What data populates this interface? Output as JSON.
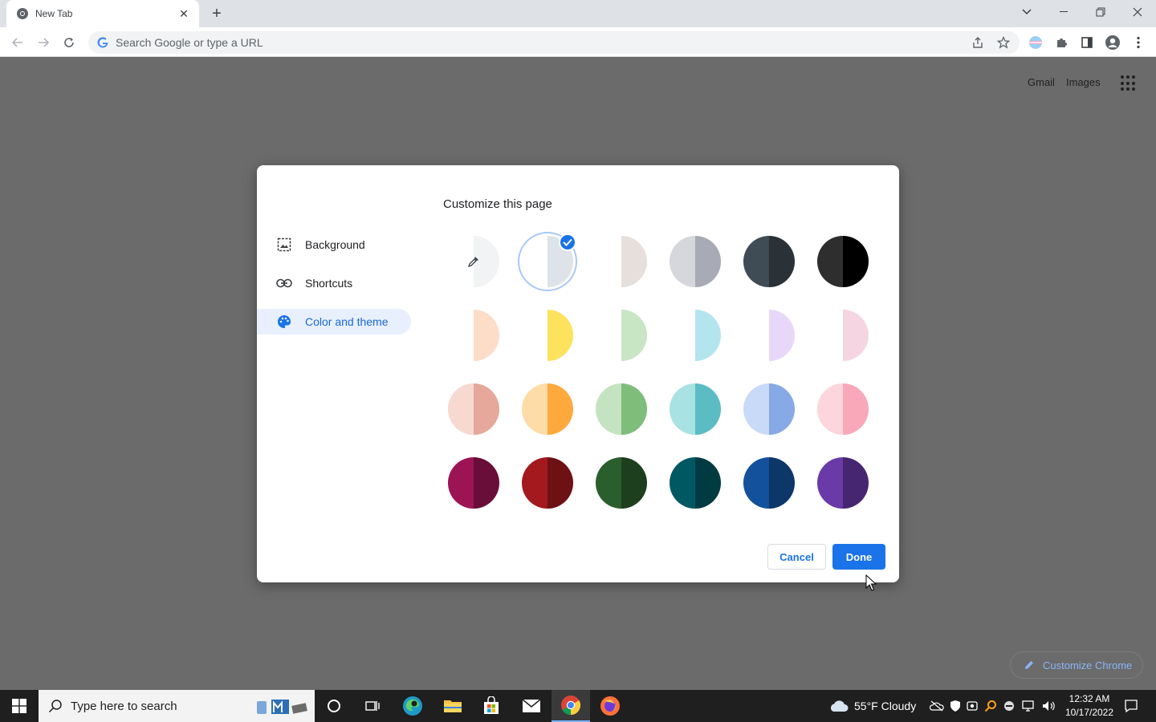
{
  "browser": {
    "tab_title": "New Tab",
    "omnibox_placeholder": "Search Google or type a URL"
  },
  "ntp": {
    "gmail": "Gmail",
    "images": "Images",
    "customize_chrome": "Customize Chrome"
  },
  "dialog": {
    "title": "Customize this page",
    "menu": [
      {
        "label": "Background",
        "icon": "image-icon"
      },
      {
        "label": "Shortcuts",
        "icon": "link-icon"
      },
      {
        "label": "Color and theme",
        "icon": "palette-icon",
        "selected": true
      }
    ],
    "swatches": [
      {
        "name": "custom-color",
        "left": "#ffffff",
        "right": "#f1f3f4",
        "icon": "eyedropper-icon"
      },
      {
        "name": "default-light",
        "left": "#ffffff",
        "right": "#dee3ea",
        "selected": true
      },
      {
        "name": "warm-grey",
        "left": "#ffffff",
        "right": "#e6dfdb"
      },
      {
        "name": "cool-grey",
        "left": "#d5d7dc",
        "right": "#a8aab5"
      },
      {
        "name": "dark-blue-grey",
        "left": "#3f4c56",
        "right": "#2a3238"
      },
      {
        "name": "black",
        "left": "#2e2e2e",
        "right": "#000000"
      },
      {
        "name": "beige-peach",
        "left": "#ffffff",
        "right": "#fddcc8"
      },
      {
        "name": "yellow",
        "left": "#ffffff",
        "right": "#fde35d"
      },
      {
        "name": "light-green",
        "left": "#ffffff",
        "right": "#c8e6c4"
      },
      {
        "name": "light-cyan",
        "left": "#ffffff",
        "right": "#b3e5ef"
      },
      {
        "name": "light-purple",
        "left": "#ffffff",
        "right": "#e7d8fa"
      },
      {
        "name": "light-pink",
        "left": "#ffffff",
        "right": "#f6d5e3"
      },
      {
        "name": "peach",
        "left": "#f7d9d2",
        "right": "#e5a89a"
      },
      {
        "name": "orange",
        "left": "#fedca8",
        "right": "#fda93d"
      },
      {
        "name": "green",
        "left": "#c4e3c0",
        "right": "#7ebd7a"
      },
      {
        "name": "cyan",
        "left": "#a8e2e3",
        "right": "#5cbcc3"
      },
      {
        "name": "blue",
        "left": "#c9daf8",
        "right": "#87a9e5"
      },
      {
        "name": "pink",
        "left": "#fcd6dc",
        "right": "#f8a8b8"
      },
      {
        "name": "magenta",
        "left": "#9d1455",
        "right": "#690d39"
      },
      {
        "name": "red",
        "left": "#a3191d",
        "right": "#6e1114"
      },
      {
        "name": "dark-green",
        "left": "#2b5e2d",
        "right": "#1d3f1e"
      },
      {
        "name": "dark-teal",
        "left": "#005862",
        "right": "#003b42"
      },
      {
        "name": "dark-blue",
        "left": "#13519c",
        "right": "#0d3669"
      },
      {
        "name": "violet",
        "left": "#6a3aa9",
        "right": "#462571"
      }
    ],
    "cancel": "Cancel",
    "done": "Done"
  },
  "taskbar": {
    "search_placeholder": "Type here to search",
    "weather": "55°F  Cloudy",
    "time": "12:32 AM",
    "date": "10/17/2022"
  },
  "colors": {
    "accent": "#1a73e8",
    "selected_bg": "#e8f0fe",
    "page_overlay": "#6b6b6b"
  }
}
